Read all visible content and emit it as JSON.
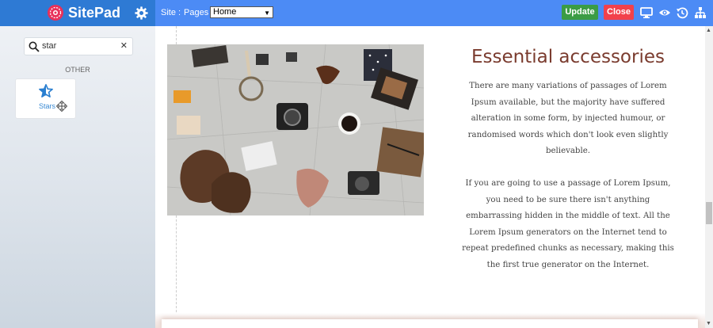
{
  "brand": {
    "name": "SitePad"
  },
  "toolbar": {
    "site_label": "Site :",
    "pages_label": "Pages :",
    "pages_selected": "Home",
    "update_label": "Update",
    "close_label": "Close"
  },
  "sidebar": {
    "search": {
      "value": "star"
    },
    "section_label": "OTHER",
    "widgets": [
      {
        "label": "Stars",
        "icon": "star-icon"
      }
    ]
  },
  "content": {
    "heading": "Essential accessories",
    "paragraph1": "There are many variations of passages of Lorem Ipsum available, but the majority have suffered alteration in some form, by injected humour, or randomised words which don't look even slightly believable.",
    "paragraph2": "If you are going to use a passage of Lorem Ipsum, you need to be sure there isn't anything embarrassing hidden in the middle of text. All the Lorem Ipsum generators on the Internet tend to repeat predefined chunks as necessary, making this the first true generator on the Internet."
  },
  "colors": {
    "topbar": "#4c8bf5",
    "brand_bg": "#2e7ad4",
    "update": "#3b9c45",
    "close": "#f2414b",
    "heading": "#7a3b2e"
  }
}
